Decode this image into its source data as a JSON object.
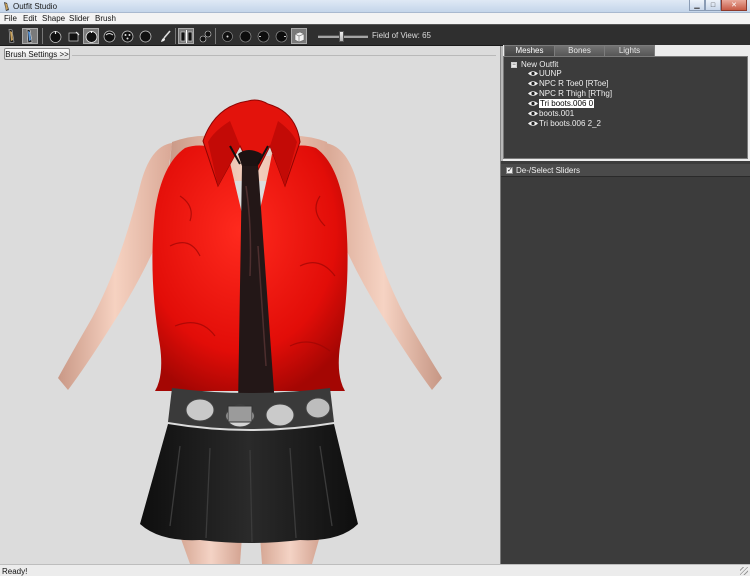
{
  "window": {
    "title": "Outfit Studio",
    "title_extra": "",
    "minimize_icon": "minimize-icon",
    "maximize_icon": "maximize-icon",
    "close_icon": "close-icon"
  },
  "menu": [
    "File",
    "Edit",
    "Shape",
    "Slider",
    "Brush"
  ],
  "toolbar": {
    "fov_label": "Field of View: 65",
    "fov_value": 65,
    "tools": [
      "select-brush-icon",
      "mask-brush-icon",
      "inflate-brush-icon",
      "deflate-brush-icon",
      "move-brush-icon",
      "smooth-brush-icon",
      "weight-brush-icon",
      "paint-brush-icon",
      "mirror-x-icon",
      "connected-only-icon",
      "brush-size-small-icon",
      "brush-size-medium-icon",
      "brush-size-large-icon",
      "brush-size-xl-icon",
      "wireframe-icon"
    ]
  },
  "viewport": {
    "brush_settings_label": "Brush Settings >>",
    "background_color": "#dcdcdc"
  },
  "tabs": [
    {
      "label": "Meshes",
      "selected": true
    },
    {
      "label": "Bones",
      "selected": false
    },
    {
      "label": "Lights",
      "selected": false
    }
  ],
  "meshes": {
    "root": "New Outfit",
    "items": [
      {
        "label": "UUNP",
        "selected": false
      },
      {
        "label": "NPC R Toe0 [RToe]",
        "selected": false
      },
      {
        "label": "NPC R Thigh [RThg]",
        "selected": false
      },
      {
        "label": "Tri boots.006 0",
        "selected": true
      },
      {
        "label": "boots.001",
        "selected": false
      },
      {
        "label": "Tri boots.006 2_2",
        "selected": false
      }
    ]
  },
  "sliders": {
    "header": "De-/Select Sliders",
    "checked": true
  },
  "status": {
    "text": "Ready!"
  },
  "colors": {
    "panel_bg": "#3c3c3c",
    "toolbar_bg": "#2f2f2f",
    "shirt": "#e01010",
    "tie": "#1a1010",
    "skirt": "#1c1c1c",
    "skin": "#efc4b0"
  }
}
